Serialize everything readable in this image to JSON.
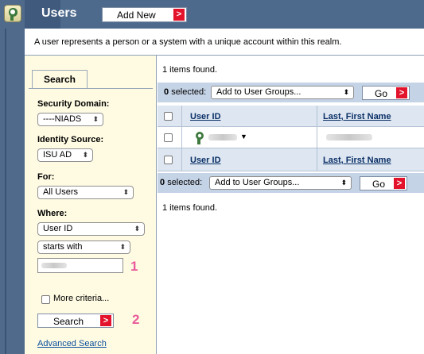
{
  "header": {
    "title": "Users",
    "add_new_label": "Add New",
    "description": "A user represents a person or a system with a unique account within this realm."
  },
  "search": {
    "tab_label": "Search",
    "security_domain_label": "Security Domain:",
    "security_domain_value": "----NIADS",
    "identity_source_label": "Identity Source:",
    "identity_source_value": "ISU AD",
    "for_label": "For:",
    "for_value": "All Users",
    "where_label": "Where:",
    "where_field_value": "User ID",
    "where_operator_value": "starts with",
    "search_text_value": "",
    "callout_1": "1",
    "callout_2": "2",
    "more_criteria_label": "More criteria...",
    "search_button_label": "Search",
    "advanced_search_link": "Advanced Search"
  },
  "results": {
    "found_text_top": "1 items found.",
    "found_text_bottom": "1 items found.",
    "top_bar": {
      "selected_count": "0",
      "selected_label": "selected:",
      "action_value": "Add to User Groups...",
      "go_label": "Go"
    },
    "bottom_bar": {
      "selected_count": "0",
      "selected_label": "selected:",
      "action_value": "Add to User Groups...",
      "go_label": "Go"
    },
    "columns": [
      "User ID",
      "Last, First Name"
    ],
    "footer_columns": [
      "User ID",
      "Last, First Name"
    ]
  },
  "colors": {
    "header_bg": "#4d6a8d",
    "action_bar_bg": "#c5d3e6",
    "left_panel_bg": "#fffbe3",
    "accent_red": "#e3132b",
    "callout_pink": "#e85b9b"
  },
  "icons": {
    "app": "user-group-icon",
    "user": "user-icon",
    "arrow": "red-right-arrow-icon"
  }
}
